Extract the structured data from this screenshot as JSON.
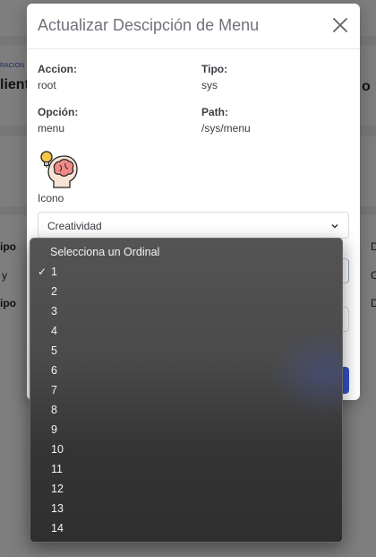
{
  "background": {
    "breadcrumb_fragment": "RACION",
    "heading_fragment": "liente",
    "heading_fragment_right": "o",
    "table_header_left": "ipo",
    "table_row_left": "y",
    "table_header_left_2": "ipo",
    "right_col_1": "D",
    "right_col_2": "C",
    "right_col_3": "D"
  },
  "modal": {
    "title": "Actualizar Descipción de Menu",
    "close_icon": "close-icon",
    "fields": {
      "accion_label": "Accion:",
      "accion_value": "root",
      "tipo_label": "Tipo:",
      "tipo_value": "sys",
      "opcion_label": "Opción:",
      "opcion_value": "menu",
      "path_label": "Path:",
      "path_value": "/sys/menu"
    },
    "icon_name": "brain-lightbulb-icon",
    "icono_label": "Icono",
    "icon_select_value": "Creatividad"
  },
  "ordinal_dropdown": {
    "header": "Selecciona un Ordinal",
    "selected": "1",
    "options": [
      "1",
      "2",
      "3",
      "4",
      "5",
      "6",
      "7",
      "8",
      "9",
      "10",
      "11",
      "12",
      "13",
      "14"
    ]
  },
  "colors": {
    "primary": "#3153c8",
    "modal_title": "#6f727a",
    "dropdown_bg": "#4a4a4a"
  }
}
